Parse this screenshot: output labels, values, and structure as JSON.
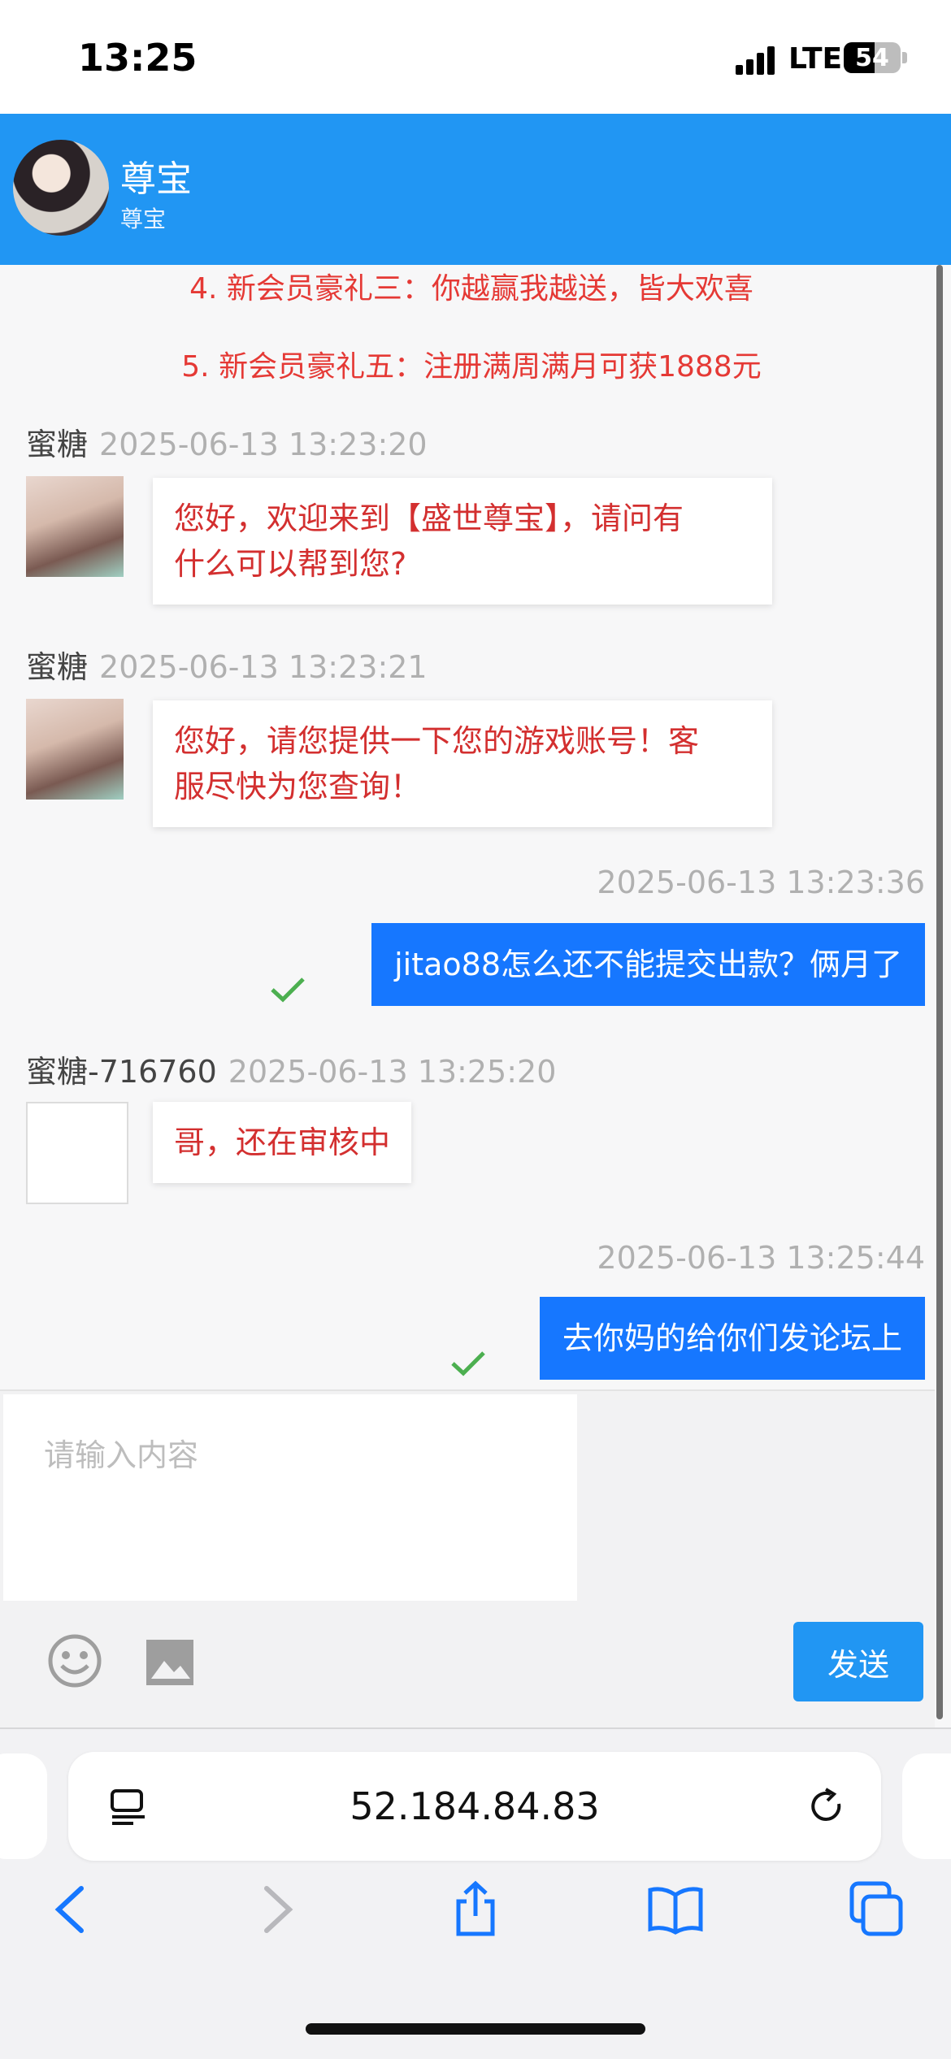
{
  "status_bar": {
    "time": "13:25",
    "network": "LTE",
    "battery": "54",
    "battery_level": 0.54
  },
  "header": {
    "title": "尊宝",
    "subtitle": "尊宝"
  },
  "notices": [
    "4. 新会员豪礼三：你越赢我越送，皆大欢喜",
    "5. 新会员豪礼五：注册满周满月可获1888元"
  ],
  "messages": [
    {
      "side": "left",
      "sender": "蜜糖",
      "timestamp": "2025-06-13 13:23:20",
      "lines": [
        "您好，欢迎来到【盛世尊宝】，请问有",
        "什么可以帮到您?"
      ]
    },
    {
      "side": "left",
      "sender": "蜜糖",
      "timestamp": "2025-06-13 13:23:21",
      "lines": [
        "您好，请您提供一下您的游戏账号！客",
        "服尽快为您查询！"
      ]
    },
    {
      "side": "right",
      "timestamp": "2025-06-13 13:23:36",
      "text": "jitao88怎么还不能提交出款？俩月了"
    },
    {
      "side": "left",
      "sender": "蜜糖-716760",
      "timestamp": "2025-06-13 13:25:20",
      "lines": [
        "哥，还在审核中"
      ]
    },
    {
      "side": "right",
      "timestamp": "2025-06-13 13:25:44",
      "text": "去你妈的给你们发论坛上"
    }
  ],
  "input": {
    "placeholder": "请输入内容",
    "send_label": "发送"
  },
  "browser": {
    "url": "52.184.84.83"
  },
  "colors": {
    "header_bg": "#2196f3",
    "user_bubble": "#1677ff",
    "agent_text": "#d32f2f",
    "read_check": "#4caf50"
  }
}
